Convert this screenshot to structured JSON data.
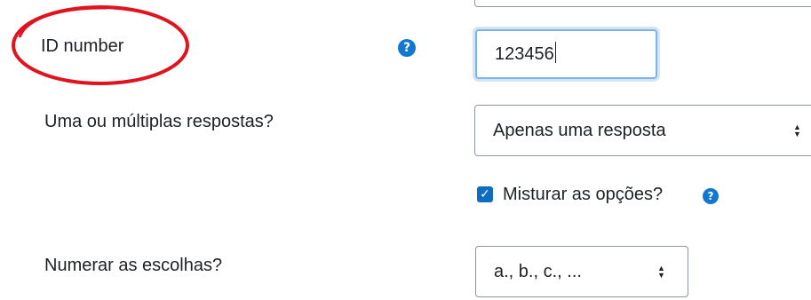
{
  "fields": {
    "id_number": {
      "label": "ID number",
      "value": "123456"
    },
    "single_multiple": {
      "label": "Uma ou múltiplas respostas?",
      "selected": "Apenas uma resposta"
    },
    "shuffle": {
      "label": "Misturar as opções?",
      "checked": true
    },
    "numbering": {
      "label": "Numerar as escolhas?",
      "selected": "a., b., c., ..."
    }
  },
  "icons": {
    "help": "?",
    "checkmark": "✓",
    "select_up": "▲",
    "select_down": "▼"
  },
  "colors": {
    "help_icon": "#1177d1",
    "checkbox": "#0f6cbf",
    "annotation": "#e0141e",
    "focus_border": "#7fb3ee"
  }
}
